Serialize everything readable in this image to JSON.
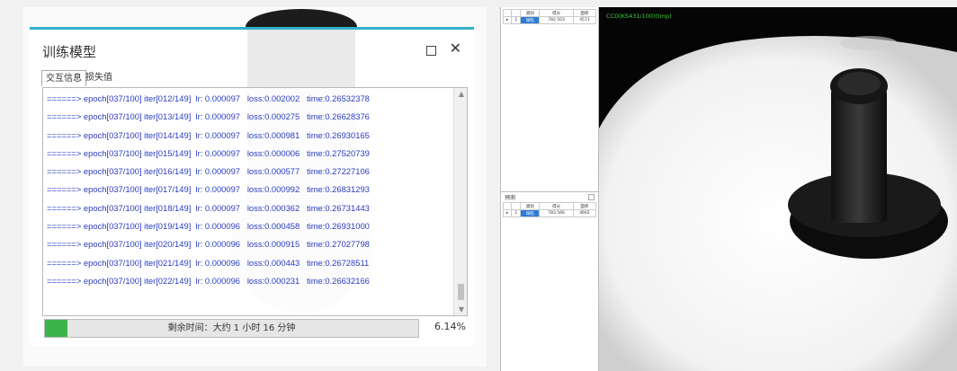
{
  "dialog": {
    "title": "训练模型",
    "maximize_icon": "maximize-icon",
    "close_label": "✕",
    "tabs": [
      {
        "label": "交互信息"
      },
      {
        "label": "损失值"
      }
    ]
  },
  "log": {
    "lines": [
      "======> epoch[037/100] iter[012/149]  lr: 0.000097   loss:0.002002   time:0.26532378",
      "======> epoch[037/100] iter[013/149]  lr: 0.000097   loss:0.000275   time:0.26628376",
      "======> epoch[037/100] iter[014/149]  lr: 0.000097   loss:0.000981   time:0.26930165",
      "======> epoch[037/100] iter[015/149]  lr: 0.000097   loss:0.000006   time:0.27520739",
      "======> epoch[037/100] iter[016/149]  lr: 0.000097   loss:0.000577   time:0.27227106",
      "======> epoch[037/100] iter[017/149]  lr: 0.000097   loss:0.000992   time:0.26831293",
      "======> epoch[037/100] iter[018/149]  lr: 0.000097   loss:0.000362   time:0.26731443",
      "======> epoch[037/100] iter[019/149]  lr: 0.000096   loss:0.000458   time:0.26931000",
      "======> epoch[037/100] iter[020/149]  lr: 0.000096   loss:0.000915   time:0.27027798",
      "======> epoch[037/100] iter[021/149]  lr: 0.000096   loss:0.000443   time:0.26728511",
      "======> epoch[037/100] iter[022/149]  lr: 0.000096   loss:0.000231   time:0.26632166"
    ]
  },
  "progress": {
    "label": "剩余时间：大约 1 小时 16 分钟",
    "percent_text": "6.14%",
    "fraction": 0.0614,
    "color": "#3bb54a"
  },
  "results": {
    "table1": {
      "headers": [
        "",
        "",
        "类别",
        "得分",
        "面积"
      ],
      "rows": [
        [
          "▸",
          "1",
          "缺陷",
          "782.503",
          "4573"
        ]
      ]
    },
    "section2_title": "预测",
    "table2": {
      "headers": [
        "",
        "",
        "类别",
        "得分",
        "面积"
      ],
      "rows": [
        [
          "▸",
          "1",
          "缺陷",
          "783.566",
          "4602"
        ]
      ]
    }
  },
  "camera": {
    "label": "CCD(KS431/100)(tmp)"
  },
  "colors": {
    "accent": "#2fb0c8",
    "log_text": "#2a3cbf",
    "selected_cell": "#2e7bd4",
    "camera_label": "#3ccf3c"
  }
}
